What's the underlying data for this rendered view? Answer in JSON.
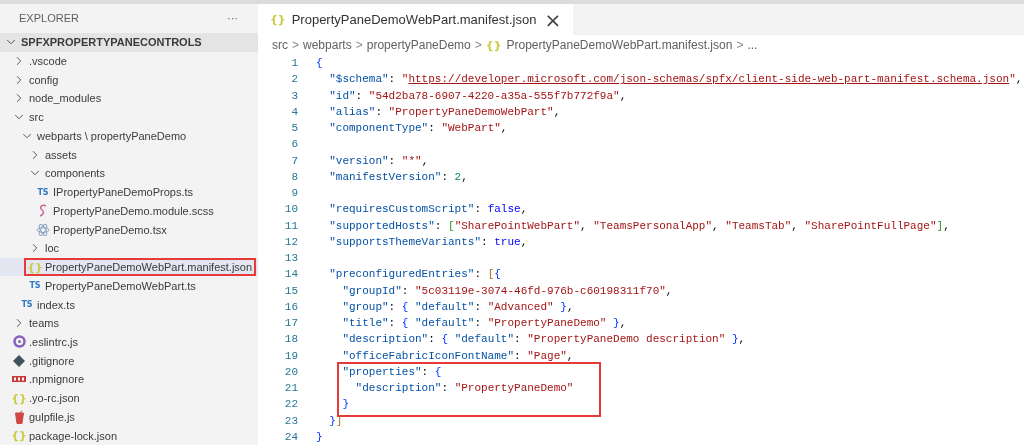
{
  "sidebar": {
    "title": "EXPLORER",
    "more": "···",
    "root": {
      "label": "SPFXPROPERTYPANECONTROLS",
      "expanded": true
    },
    "items": [
      {
        "kind": "folder",
        "label": ".vscode",
        "expanded": false
      },
      {
        "kind": "folder",
        "label": "config",
        "expanded": false
      },
      {
        "kind": "folder",
        "label": "node_modules",
        "expanded": false
      },
      {
        "kind": "folder",
        "label": "src",
        "expanded": true,
        "children": [
          {
            "kind": "folder",
            "label": "webparts \\ propertyPaneDemo",
            "expanded": true,
            "children": [
              {
                "kind": "folder",
                "label": "assets",
                "expanded": false
              },
              {
                "kind": "folder",
                "label": "components",
                "expanded": true,
                "children": [
                  {
                    "kind": "ts-file",
                    "badge": "TS",
                    "label": "IPropertyPaneDemoProps.ts",
                    "selected": false
                  },
                  {
                    "kind": "scss-file",
                    "label": "PropertyPaneDemo.module.scss",
                    "selected": false
                  },
                  {
                    "kind": "react-file",
                    "label": "PropertyPaneDemo.tsx",
                    "selected": false
                  }
                ]
              },
              {
                "kind": "folder",
                "label": "loc",
                "expanded": false
              },
              {
                "kind": "json-file",
                "badge": "{}",
                "label": "PropertyPaneDemoWebPart.manifest.json",
                "selected": true,
                "annotated": true
              },
              {
                "kind": "ts-file",
                "badge": "TS",
                "label": "PropertyPaneDemoWebPart.ts",
                "selected": false
              }
            ]
          },
          {
            "kind": "ts-file",
            "badge": "TS",
            "label": "index.ts",
            "selected": false
          }
        ]
      },
      {
        "kind": "folder",
        "label": "teams",
        "expanded": false
      },
      {
        "kind": "eslint-file",
        "label": ".eslintrc.js",
        "selected": false
      },
      {
        "kind": "git-file",
        "label": ".gitignore",
        "selected": false
      },
      {
        "kind": "npm-file",
        "label": ".npmignore",
        "selected": false
      },
      {
        "kind": "json-file",
        "badge": "{}",
        "label": ".yo-rc.json",
        "selected": false
      },
      {
        "kind": "gulp-file",
        "label": "gulpfile.js",
        "selected": false
      },
      {
        "kind": "json-file",
        "badge": "{}",
        "label": "package-lock.json",
        "selected": false
      }
    ]
  },
  "tab": {
    "badge": "{}",
    "label": "PropertyPaneDemoWebPart.manifest.json",
    "close": "×",
    "selected": true
  },
  "breadcrumb": [
    {
      "label": "src"
    },
    {
      "label": "webparts"
    },
    {
      "label": "propertyPaneDemo"
    },
    {
      "label": "PropertyPaneDemoWebPart.manifest.json",
      "badge": "{}"
    },
    {
      "label": "..."
    }
  ],
  "breadcrumb_separator": ">",
  "code": [
    {
      "number": "1",
      "tokens": [
        {
          "kind": "b1",
          "text": "{"
        }
      ],
      "children": [
        {
          "number": "2",
          "tokens": [
            {
              "kind": "key",
              "text": "\"$schema\""
            },
            {
              "kind": "p",
              "text": ": "
            },
            {
              "kind": "str",
              "text": "\""
            },
            {
              "kind": "url",
              "text": "https://developer.microsoft.com/json-schemas/spfx/client-side-web-part-manifest.schema.json"
            },
            {
              "kind": "str",
              "text": "\""
            },
            {
              "kind": "p",
              "text": ","
            }
          ]
        },
        {
          "number": "3",
          "tokens": [
            {
              "kind": "key",
              "text": "\"id\""
            },
            {
              "kind": "p",
              "text": ": "
            },
            {
              "kind": "str",
              "text": "\"54d2ba78-6907-4220-a35a-555f7b772f9a\""
            },
            {
              "kind": "p",
              "text": ","
            }
          ]
        },
        {
          "number": "4",
          "tokens": [
            {
              "kind": "key",
              "text": "\"alias\""
            },
            {
              "kind": "p",
              "text": ": "
            },
            {
              "kind": "str",
              "text": "\"PropertyPaneDemoWebPart\""
            },
            {
              "kind": "p",
              "text": ","
            }
          ]
        },
        {
          "number": "5",
          "tokens": [
            {
              "kind": "key",
              "text": "\"componentType\""
            },
            {
              "kind": "p",
              "text": ": "
            },
            {
              "kind": "str",
              "text": "\"WebPart\""
            },
            {
              "kind": "p",
              "text": ","
            }
          ]
        },
        {
          "number": "6"
        },
        {
          "number": "7",
          "tokens": [
            {
              "kind": "key",
              "text": "\"version\""
            },
            {
              "kind": "p",
              "text": ": "
            },
            {
              "kind": "str",
              "text": "\"*\""
            },
            {
              "kind": "p",
              "text": ","
            }
          ]
        },
        {
          "number": "8",
          "tokens": [
            {
              "kind": "key",
              "text": "\"manifestVersion\""
            },
            {
              "kind": "p",
              "text": ": "
            },
            {
              "kind": "num",
              "text": "2"
            },
            {
              "kind": "p",
              "text": ","
            }
          ]
        },
        {
          "number": "9"
        },
        {
          "number": "10",
          "tokens": [
            {
              "kind": "key",
              "text": "\"requiresCustomScript\""
            },
            {
              "kind": "p",
              "text": ": "
            },
            {
              "kind": "bool",
              "text": "false"
            },
            {
              "kind": "p",
              "text": ","
            }
          ]
        },
        {
          "number": "11",
          "tokens": [
            {
              "kind": "key",
              "text": "\"supportedHosts\""
            },
            {
              "kind": "p",
              "text": ": "
            },
            {
              "kind": "b2",
              "text": "["
            },
            {
              "kind": "str",
              "text": "\"SharePointWebPart\""
            },
            {
              "kind": "p",
              "text": ", "
            },
            {
              "kind": "str",
              "text": "\"TeamsPersonalApp\""
            },
            {
              "kind": "p",
              "text": ", "
            },
            {
              "kind": "str",
              "text": "\"TeamsTab\""
            },
            {
              "kind": "p",
              "text": ", "
            },
            {
              "kind": "str",
              "text": "\"SharePointFullPage\""
            },
            {
              "kind": "b2",
              "text": "]"
            },
            {
              "kind": "p",
              "text": ","
            }
          ]
        },
        {
          "number": "12",
          "tokens": [
            {
              "kind": "key",
              "text": "\"supportsThemeVariants\""
            },
            {
              "kind": "p",
              "text": ": "
            },
            {
              "kind": "bool",
              "text": "true"
            },
            {
              "kind": "p",
              "text": ","
            }
          ]
        },
        {
          "number": "13"
        },
        {
          "number": "14",
          "tokens": [
            {
              "kind": "key",
              "text": "\"preconfiguredEntries\""
            },
            {
              "kind": "p",
              "text": ": "
            },
            {
              "kind": "b3",
              "text": "["
            },
            {
              "kind": "b1",
              "text": "{"
            }
          ],
          "children": [
            {
              "number": "15",
              "tokens": [
                {
                  "kind": "key",
                  "text": "\"groupId\""
                },
                {
                  "kind": "p",
                  "text": ": "
                },
                {
                  "kind": "str",
                  "text": "\"5c03119e-3074-46fd-976b-c60198311f70\""
                },
                {
                  "kind": "p",
                  "text": ","
                }
              ]
            },
            {
              "number": "16",
              "tokens": [
                {
                  "kind": "key",
                  "text": "\"group\""
                },
                {
                  "kind": "p",
                  "text": ": "
                },
                {
                  "kind": "b1",
                  "text": "{"
                },
                {
                  "kind": "key",
                  "text": " \"default\""
                },
                {
                  "kind": "p",
                  "text": ": "
                },
                {
                  "kind": "str",
                  "text": "\"Advanced\" "
                },
                {
                  "kind": "b1",
                  "text": "}"
                },
                {
                  "kind": "p",
                  "text": ","
                }
              ]
            },
            {
              "number": "17",
              "tokens": [
                {
                  "kind": "key",
                  "text": "\"title\""
                },
                {
                  "kind": "p",
                  "text": ": "
                },
                {
                  "kind": "b1",
                  "text": "{"
                },
                {
                  "kind": "key",
                  "text": " \"default\""
                },
                {
                  "kind": "p",
                  "text": ": "
                },
                {
                  "kind": "str",
                  "text": "\"PropertyPaneDemo\" "
                },
                {
                  "kind": "b1",
                  "text": "}"
                },
                {
                  "kind": "p",
                  "text": ","
                }
              ]
            },
            {
              "number": "18",
              "tokens": [
                {
                  "kind": "key",
                  "text": "\"description\""
                },
                {
                  "kind": "p",
                  "text": ": "
                },
                {
                  "kind": "b1",
                  "text": "{"
                },
                {
                  "kind": "key",
                  "text": " \"default\""
                },
                {
                  "kind": "p",
                  "text": ": "
                },
                {
                  "kind": "str",
                  "text": "\"PropertyPaneDemo description\" "
                },
                {
                  "kind": "b1",
                  "text": "}"
                },
                {
                  "kind": "p",
                  "text": ","
                }
              ]
            },
            {
              "number": "19",
              "tokens": [
                {
                  "kind": "key",
                  "text": "\"officeFabricIconFontName\""
                },
                {
                  "kind": "p",
                  "text": ": "
                },
                {
                  "kind": "str",
                  "text": "\"Page\""
                },
                {
                  "kind": "p",
                  "text": ","
                }
              ]
            },
            {
              "number": "20",
              "boxed": true,
              "tokens": [
                {
                  "kind": "key",
                  "text": "\"properties\""
                },
                {
                  "kind": "p",
                  "text": ": "
                },
                {
                  "kind": "b1",
                  "text": "{"
                }
              ],
              "children": [
                {
                  "number": "21",
                  "boxed": true,
                  "tokens": [
                    {
                      "kind": "key",
                      "text": "\"description\""
                    },
                    {
                      "kind": "p",
                      "text": ": "
                    },
                    {
                      "kind": "str",
                      "text": "\"PropertyPaneDemo\""
                    }
                  ]
                }
              ]
            },
            {
              "number": "22",
              "boxed": true,
              "tokens": [
                {
                  "kind": "b1",
                  "text": "}"
                }
              ]
            }
          ]
        },
        {
          "number": "23",
          "tokens": [
            {
              "kind": "b1",
              "text": "}"
            },
            {
              "kind": "b3",
              "text": "]"
            }
          ]
        }
      ]
    },
    {
      "number": "24",
      "tokens": [
        {
          "kind": "b1",
          "text": "}"
        }
      ]
    }
  ]
}
